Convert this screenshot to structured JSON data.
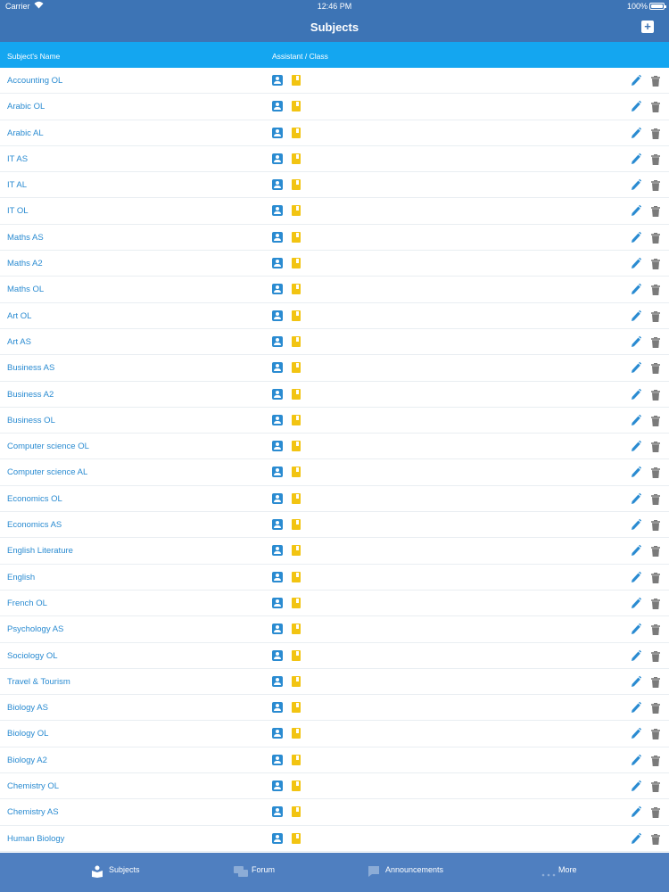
{
  "status_bar": {
    "carrier": "Carrier",
    "time": "12:46 PM",
    "battery": "100%"
  },
  "nav": {
    "title": "Subjects",
    "add_icon": "plus-square-icon"
  },
  "table": {
    "columns": {
      "name": "Subject's Name",
      "assistant_class": "Assistant / Class"
    },
    "rows": [
      "Accounting OL",
      "Arabic OL",
      "Arabic AL",
      "IT AS",
      "IT AL",
      "IT OL",
      "Maths AS",
      "Maths A2",
      "Maths OL",
      "Art OL",
      "Art AS",
      "Business AS",
      "Business A2",
      "Business OL",
      "Computer science OL",
      "Computer science AL",
      "Economics OL",
      "Economics AS",
      "English Literature",
      "English",
      "French OL",
      "Psychology AS",
      "Sociology OL",
      "Travel & Tourism",
      "Biology AS",
      "Biology OL",
      "Biology A2",
      "Chemistry OL",
      "Chemistry AS",
      "Human Biology"
    ],
    "colors": {
      "link": "#2a8bd1",
      "assistant_icon": "#2a8bd1",
      "class_icon": "#f2c412",
      "header_bg": "#14a6f0"
    }
  },
  "tabbar": {
    "tabs": [
      {
        "label": "Subjects",
        "icon": "book-icon",
        "active": true
      },
      {
        "label": "Forum",
        "icon": "chat-bubbles-icon",
        "active": false
      },
      {
        "label": "Announcements",
        "icon": "announcement-icon",
        "active": false
      },
      {
        "label": "More",
        "icon": "more-dots-icon",
        "active": false
      }
    ]
  },
  "theme": {
    "nav_bg": "#3d74b5",
    "tabbar_bg": "#4f7fc0"
  }
}
